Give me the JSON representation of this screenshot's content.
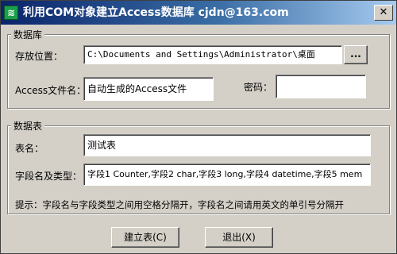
{
  "window": {
    "title": "利用COM对象建立Access数据库  cjdn@163.com",
    "close_label": "✕"
  },
  "database_group": {
    "legend": "数据库",
    "location_label": "存放位置：",
    "location_value": "C:\\Documents and Settings\\Administrator\\桌面",
    "browse_label": "...",
    "filename_label": "Access文件名：",
    "filename_value": "自动生成的Access文件",
    "password_label": "密码：",
    "password_value": ""
  },
  "table_group": {
    "legend": "数据表",
    "table_name_label": "表名：",
    "table_name_value": "测试表",
    "fields_label": "字段名及类型：",
    "fields_value": "字段1 Counter,字段2 char,字段3 long,字段4 datetime,字段5 mem",
    "hint": "提示：字段名与字段类型之间用空格分隔开，字段名之间请用英文的单引号分隔开"
  },
  "buttons": {
    "create_label": "建立表(C)",
    "exit_label": "退出(X)"
  }
}
